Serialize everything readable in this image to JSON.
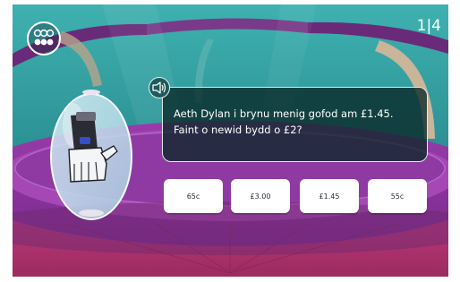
{
  "header": {
    "menu_icon": "nine-dots-menu-icon",
    "counter": "1|4"
  },
  "question": {
    "speaker_icon": "speaker-icon",
    "text": "Aeth Dylan i brynu menig gofod am £1.45. Faint o newid bydd o £2?"
  },
  "answers": [
    {
      "label": "65c"
    },
    {
      "label": "£3.00"
    },
    {
      "label": "£1.45"
    },
    {
      "label": "55c"
    }
  ],
  "colors": {
    "sky": "#2f9c9f",
    "platform": "#8c2f9c",
    "floor": "#b0356f",
    "question_bg": "#0a2828"
  }
}
